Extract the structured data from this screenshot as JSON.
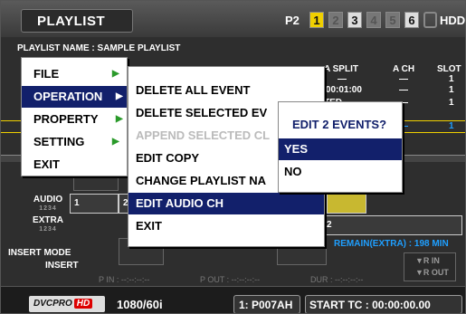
{
  "header": {
    "title": "PLAYLIST",
    "p2": "P2",
    "slots": [
      "1",
      "2",
      "3",
      "4",
      "5",
      "6"
    ],
    "hdd": "HDD"
  },
  "list": {
    "name_label": "PLAYLIST NAME : SAMPLE PLAYLIST",
    "col_a_split": "A SPLIT",
    "col_a_ch": "A CH",
    "col_slot": "SLOT",
    "rows": [
      {
        "time": "0:00:01:00",
        "dash": "—",
        "slot": "1"
      },
      {
        "status": "TED",
        "dash": "—",
        "slot": "1"
      },
      {
        "dash": "—",
        "slot": "1"
      }
    ],
    "first_row_dash": "—",
    "first_row_slot": "1"
  },
  "tracks": {
    "audio_label": "AUDIO",
    "audio_sub": "1234",
    "audio_clip1": "1",
    "audio_clip2": "2",
    "extra_label": "EXTRA",
    "extra_sub": "1234",
    "extra_clip": "2",
    "remain": "REMAIN(EXTRA) : 198 MIN",
    "insert_mode_label": "INSERT MODE",
    "insert_mode_value": "INSERT",
    "p_in": "P IN : --:--:--:--",
    "p_out": "P OUT : --:--:--:--",
    "dur": "DUR : --:--:--:--",
    "r_in": "▼R IN",
    "r_out": "▼R OUT"
  },
  "menu1": {
    "items": [
      "FILE",
      "OPERATION",
      "PROPERTY",
      "SETTING",
      "EXIT"
    ],
    "selected": 1
  },
  "menu2": {
    "items": [
      "DELETE ALL EVENT",
      "DELETE SELECTED EV",
      "APPEND SELECTED CL",
      "EDIT COPY",
      "CHANGE PLAYLIST NA",
      "EDIT AUDIO CH",
      "EXIT"
    ],
    "selected": 5,
    "disabled": 2
  },
  "dialog": {
    "question": "EDIT 2 EVENTS?",
    "yes": "YES",
    "no": "NO"
  },
  "footer": {
    "logo_text": "DVCPRO",
    "logo_hd": "HD",
    "format": "1080/60i",
    "clip": "1: P007AH",
    "tc": "START TC   : 00:00:00.00"
  },
  "colors": {
    "accent": "#12206b",
    "slot_active": "#f0d000",
    "audio_yellow": "#c8b830"
  }
}
